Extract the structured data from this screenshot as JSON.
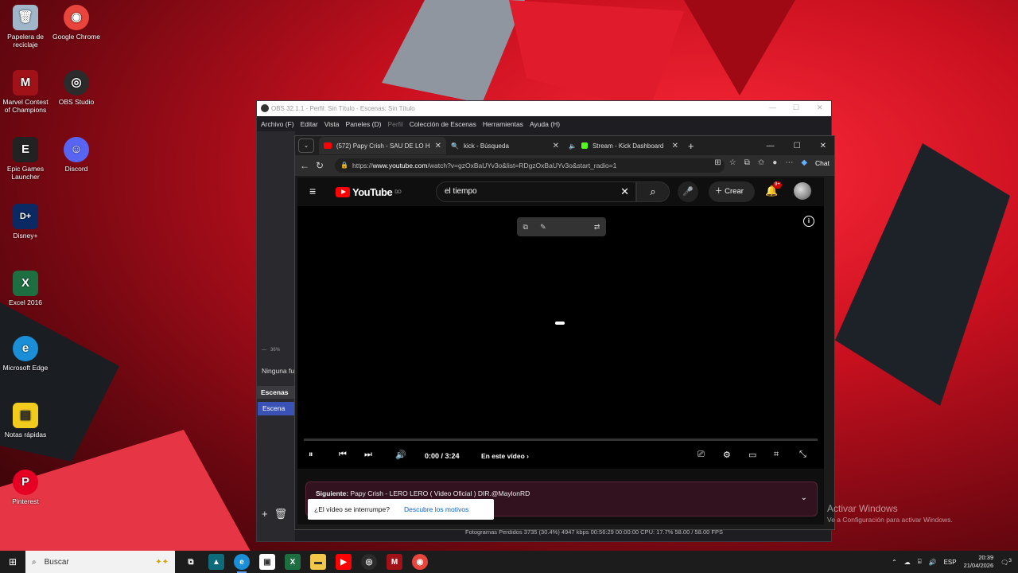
{
  "desktop": {
    "icons": [
      {
        "label": "Papelera de reciclaje",
        "icon": "recycle-bin-icon",
        "color": "#9fb7c9",
        "glyph": "🗑"
      },
      {
        "label": "Google Chrome",
        "icon": "chrome-icon",
        "color": "#e8453c",
        "glyph": "◉"
      },
      {
        "label": "Marvel Contest of Champions",
        "icon": "mcoc-icon",
        "color": "#a01218",
        "glyph": "M"
      },
      {
        "label": "OBS Studio",
        "icon": "obs-icon",
        "color": "#2b2b2b",
        "glyph": "◎"
      },
      {
        "label": "Epic Games Launcher",
        "icon": "epic-icon",
        "color": "#222222",
        "glyph": "E"
      },
      {
        "label": "Discord",
        "icon": "discord-icon",
        "color": "#5865f2",
        "glyph": "☺"
      },
      {
        "label": "Disney+",
        "icon": "disney-icon",
        "color": "#0b2a63",
        "glyph": "D+"
      },
      {
        "label": "Excel 2016",
        "icon": "excel-icon",
        "color": "#1d6f42",
        "glyph": "X"
      },
      {
        "label": "Microsoft Edge",
        "icon": "edge-icon",
        "color": "#1a8ed6",
        "glyph": "e"
      },
      {
        "label": "Notas rápidas",
        "icon": "sticky-notes-icon",
        "color": "#f2cc1c",
        "glyph": "▤"
      },
      {
        "label": "Pinterest",
        "icon": "pinterest-icon",
        "color": "#e60023",
        "glyph": "P"
      }
    ],
    "activate": {
      "title": "Activar Windows",
      "subtitle": "Ve a Configuración para activar Windows."
    }
  },
  "obs": {
    "title": "OBS 32.1.1 - Perfil: Sin Título - Escenas: Sin Título",
    "menu": [
      "Archivo (F)",
      "Editar",
      "Vista",
      "Paneles (D)",
      "Perfil",
      "Colección de Escenas",
      "Herramientas",
      "Ayuda (H)"
    ],
    "zoom": "36%",
    "source_label": "Ninguna fu",
    "scenes_header": "Escenas",
    "scene_item": "Escena",
    "status": "Fotogramas Perdidos 3735 (30.4%)   4947 kbps   00:56:29   00:00:00   CPU: 17.7%   58.00 / 58.00 FPS"
  },
  "browser": {
    "tabs": [
      {
        "label": "(572) Papy Crish - SAU DE LO HO",
        "icon": "youtube-icon",
        "color": "#ff0000"
      },
      {
        "label": "kick - Búsqueda",
        "icon": "search-icon",
        "color": "#4aa3ff"
      },
      {
        "label": "Stream - Kick Dashboard",
        "icon": "kick-icon",
        "color": "#53fc18"
      }
    ],
    "url_prefix": "https://",
    "url_host": "www.youtube.com",
    "url_path": "/watch?v=gzOxBaUYv3o&list=RDgzOxBaUYv3o&start_radio=1",
    "chat_label": "Chat"
  },
  "youtube": {
    "brand": "YouTube",
    "brand_suffix": "DO",
    "search_value": "el tiempo",
    "create_label": "Crear",
    "notifications": "9+",
    "time": "0:00 / 3:24",
    "chapter": "En este vídeo",
    "progress": 0,
    "next_prefix": "Siguiente:",
    "next_title": "Papy Crish - LERO LERO ( Video Oficial ) DIR.@MaylonRD",
    "interrupt_question": "¿El vídeo se interrumpe?",
    "interrupt_link": "Descubre los motivos"
  },
  "taskbar": {
    "search_label": "Buscar",
    "lang": "ESP",
    "time": "20:39",
    "date": "21/04/2026",
    "notif_count": "3"
  }
}
